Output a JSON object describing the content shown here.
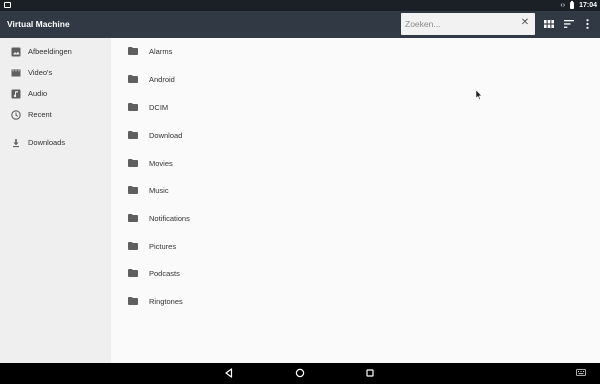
{
  "status_bar": {
    "time": "17:04"
  },
  "toolbar": {
    "title": "Virtual Machine",
    "search_placeholder": "Zoeken...",
    "clear_label": "✕"
  },
  "sidebar": {
    "items": [
      {
        "label": "Afbeeldingen",
        "icon": "image-icon"
      },
      {
        "label": "Video's",
        "icon": "video-icon"
      },
      {
        "label": "Audio",
        "icon": "audio-icon"
      },
      {
        "label": "Recent",
        "icon": "clock-icon"
      },
      {
        "label": "Downloads",
        "icon": "download-icon"
      }
    ]
  },
  "files": [
    {
      "name": "Alarms"
    },
    {
      "name": "Android"
    },
    {
      "name": "DCIM"
    },
    {
      "name": "Download"
    },
    {
      "name": "Movies"
    },
    {
      "name": "Music"
    },
    {
      "name": "Notifications"
    },
    {
      "name": "Pictures"
    },
    {
      "name": "Podcasts"
    },
    {
      "name": "Ringtones"
    }
  ],
  "colors": {
    "status_bar": "#1b2027",
    "toolbar": "#313a44",
    "sidebar": "#efefef",
    "content": "#fafafa",
    "icon": "#5f5f5f"
  }
}
